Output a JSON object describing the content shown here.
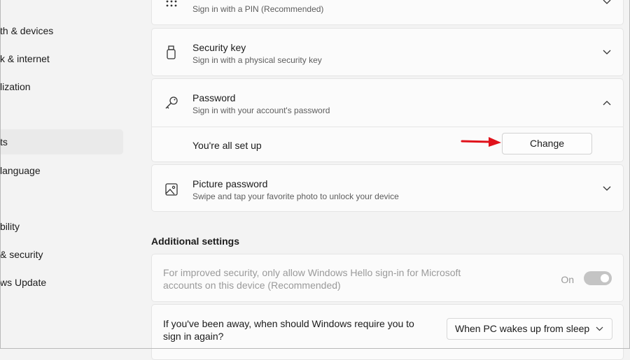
{
  "sidebar": {
    "items": [
      {
        "label": "th & devices"
      },
      {
        "label": "k & internet"
      },
      {
        "label": "lization"
      },
      {
        "label": "ts"
      },
      {
        "label": "language"
      },
      {
        "label": "bility"
      },
      {
        "label": "& security"
      },
      {
        "label": "ws Update"
      }
    ]
  },
  "pin": {
    "subtitle": "Sign in with a PIN (Recommended)"
  },
  "security_key": {
    "title": "Security key",
    "subtitle": "Sign in with a physical security key"
  },
  "password": {
    "title": "Password",
    "subtitle": "Sign in with your account's password",
    "status": "You're all set up",
    "change_label": "Change"
  },
  "picture_password": {
    "title": "Picture password",
    "subtitle": "Swipe and tap your favorite photo to unlock your device"
  },
  "additional": {
    "heading": "Additional settings",
    "hello_only": {
      "line1": "For improved security, only allow Windows Hello sign-in for Microsoft",
      "line2": "accounts on this device (Recommended)",
      "toggle_label": "On",
      "toggle_on": true
    },
    "away": {
      "line1": "If you've been away, when should Windows require you to",
      "line2": "sign in again?",
      "selected": "When PC wakes up from sleep"
    }
  },
  "colors": {
    "accent_arrow": "#e0121b",
    "background": "#f3f3f3",
    "card": "#fbfbfb"
  },
  "icons": [
    "pin-keypad-icon",
    "usb-key-icon",
    "key-icon",
    "picture-icon",
    "chevron-down-icon",
    "chevron-up-icon",
    "red-arrow-annotation"
  ]
}
